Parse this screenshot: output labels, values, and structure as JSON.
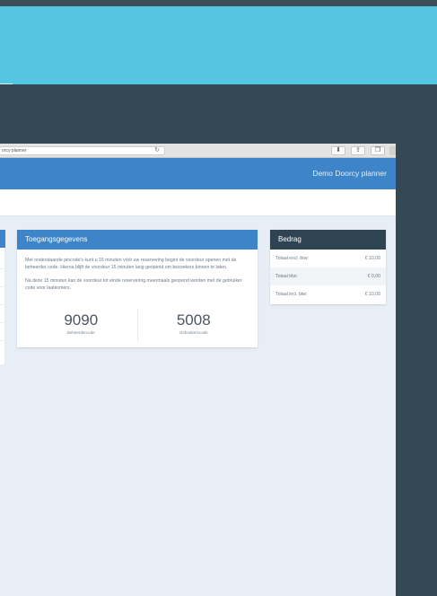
{
  "browser": {
    "url": "orcy planner",
    "reload_icon": "reload-icon",
    "toolbar_icons": [
      "download-icon",
      "share-icon",
      "tabs-icon"
    ]
  },
  "app": {
    "title": "Demo Doorcy planner"
  },
  "access_card": {
    "title": "Toegangsgegevens",
    "paragraph_1": "Met onderstaande pincode's kunt u 15 minuten vóór uw reservering begint de voordeur openen met de beheerder code. Hierna blijft de voordeur 15 minuten lang geopend om bezoekers binnen te laten.",
    "paragraph_2": "Na deze 15 minuten kan de voordeur tot einde reservering meermaals geopend worden met de gebruiker code voor laatkomers.",
    "codes": [
      {
        "value": "9090",
        "label": "Beheerdercode"
      },
      {
        "value": "5008",
        "label": "Gebruikerscode"
      }
    ]
  },
  "amount_card": {
    "title": "Bedrag",
    "rows": [
      {
        "label": "Totaal excl. btw:",
        "value": "€ 10,00"
      },
      {
        "label": "Totaal btw:",
        "value": "€ 0,00"
      },
      {
        "label": "Totaal incl. btw:",
        "value": "€ 10,00"
      }
    ]
  },
  "colors": {
    "accent_blue": "#3d84c9",
    "cyan_band": "#55c6e2",
    "dark_slate": "#344955",
    "amount_header": "#2f4452"
  }
}
